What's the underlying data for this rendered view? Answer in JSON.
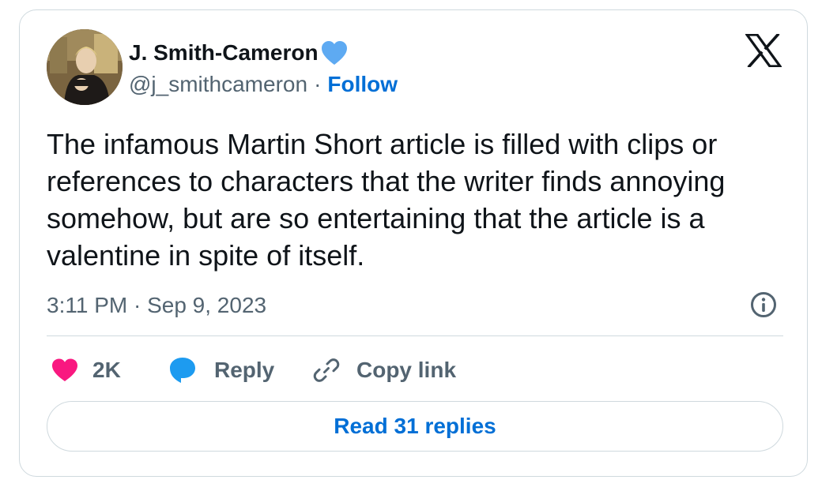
{
  "author": {
    "display_name": "J. Smith-Cameron",
    "handle": "@j_smithcameron",
    "separator": "·",
    "follow_label": "Follow",
    "avatar_icon": "profile-photo",
    "verified_icon": "verified-heart-icon"
  },
  "tweet": {
    "text": "The infamous Martin Short article is filled with clips or references to characters that the writer finds annoying somehow, but are so entertaining that the article is a valentine in spite of itself.",
    "timestamp": "3:11 PM · Sep 9, 2023"
  },
  "actions": {
    "like_count": "2K",
    "reply_label": "Reply",
    "copy_link_label": "Copy link"
  },
  "footer": {
    "read_replies_label": "Read 31 replies"
  },
  "colors": {
    "accent": "#006fd6",
    "heart": "#f91880",
    "reply_bubble": "#1d9bf0",
    "verified": "#5eaaf2",
    "muted_text": "#536471",
    "border": "#cfd9de"
  }
}
